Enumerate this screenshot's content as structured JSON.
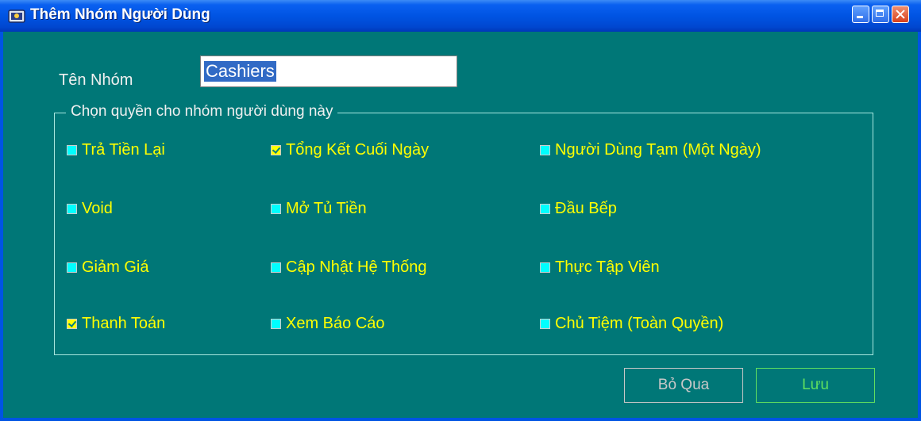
{
  "window": {
    "title": "Thêm Nhóm Người Dùng"
  },
  "form": {
    "name_label": "Tên Nhóm",
    "name_value": "Cashiers"
  },
  "permissions": {
    "legend": "Chọn quyền cho nhóm người dùng này",
    "items": [
      {
        "label": "Trả Tiền Lại",
        "checked": false
      },
      {
        "label": "Tổng Kết Cuối Ngày",
        "checked": true
      },
      {
        "label": "Người Dùng Tạm (Một Ngày)",
        "checked": false
      },
      {
        "label": "Void",
        "checked": false
      },
      {
        "label": "Mở Tủ Tiền",
        "checked": false
      },
      {
        "label": "Đầu Bếp",
        "checked": false
      },
      {
        "label": "Giảm Giá",
        "checked": false
      },
      {
        "label": "Cập Nhật Hệ Thống",
        "checked": false
      },
      {
        "label": "Thực Tập Viên",
        "checked": false
      },
      {
        "label": "Thanh Toán",
        "checked": true
      },
      {
        "label": "Xem Báo Cáo",
        "checked": false
      },
      {
        "label": "Chủ Tiệm (Toàn Quyền)",
        "checked": false
      }
    ]
  },
  "buttons": {
    "cancel_label": "Bỏ Qua",
    "save_label": "Lưu"
  },
  "colors": {
    "client_bg": "#007777",
    "permission_text": "#ffff00",
    "checkbox_unchecked": "#00ffff",
    "save_accent": "#5fe05f"
  }
}
